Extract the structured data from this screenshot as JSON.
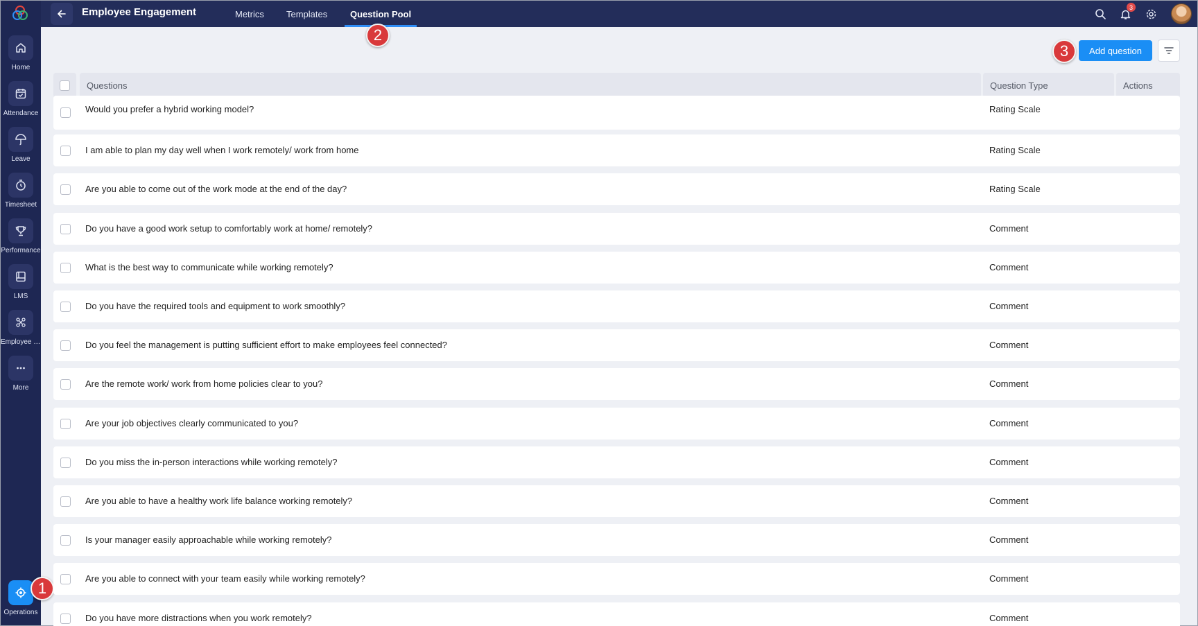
{
  "sidebar": {
    "items": [
      {
        "label": "Home",
        "icon": "home-icon"
      },
      {
        "label": "Attendance",
        "icon": "calendar-check-icon"
      },
      {
        "label": "Leave",
        "icon": "umbrella-icon"
      },
      {
        "label": "Timesheet",
        "icon": "stopwatch-icon"
      },
      {
        "label": "Performance",
        "icon": "trophy-icon"
      },
      {
        "label": "LMS",
        "icon": "book-icon"
      },
      {
        "label": "Employee E...",
        "icon": "engagement-icon"
      },
      {
        "label": "More",
        "icon": "more-dots-icon"
      }
    ],
    "operations_label": "Operations"
  },
  "header": {
    "title": "Employee Engagement",
    "tabs": [
      "Metrics",
      "Templates",
      "Question Pool"
    ],
    "active_tab": "Question Pool",
    "notification_count": "3"
  },
  "markers": [
    "1",
    "2",
    "3"
  ],
  "toolbar": {
    "add_label": "Add question"
  },
  "table": {
    "columns": [
      "Questions",
      "Question Type",
      "Actions"
    ],
    "rows": [
      {
        "question": "Would you prefer a hybrid working model?",
        "type": "Rating Scale"
      },
      {
        "question": "I am able to plan my day well when I work remotely/ work from home",
        "type": "Rating Scale"
      },
      {
        "question": "Are you able to come out of the work mode at the end of the day?",
        "type": "Rating Scale"
      },
      {
        "question": "Do you have a good work setup to comfortably work at home/ remotely?",
        "type": "Comment"
      },
      {
        "question": "What is the best way to communicate while working remotely?",
        "type": "Comment"
      },
      {
        "question": "Do you have the required tools and equipment to work smoothly?",
        "type": "Comment"
      },
      {
        "question": "Do you feel the management is putting sufficient effort to make employees feel connected?",
        "type": "Comment"
      },
      {
        "question": "Are the remote work/ work from home policies clear to you?",
        "type": "Comment"
      },
      {
        "question": "Are your job objectives clearly communicated to you?",
        "type": "Comment"
      },
      {
        "question": "Do you miss the in-person interactions while working remotely?",
        "type": "Comment"
      },
      {
        "question": "Are you able to have a healthy work life balance working remotely?",
        "type": "Comment"
      },
      {
        "question": "Is your manager easily approachable while working remotely?",
        "type": "Comment"
      },
      {
        "question": "Are you able to connect with your team easily while working remotely?",
        "type": "Comment"
      },
      {
        "question": "Do you have more distractions when you work remotely?",
        "type": "Comment"
      }
    ]
  },
  "colors": {
    "sidebar_bg": "#1e2753",
    "topbar_bg": "#232d5a",
    "accent": "#1a8ef5",
    "marker": "#d9393b",
    "page_bg": "#eef0f5"
  }
}
